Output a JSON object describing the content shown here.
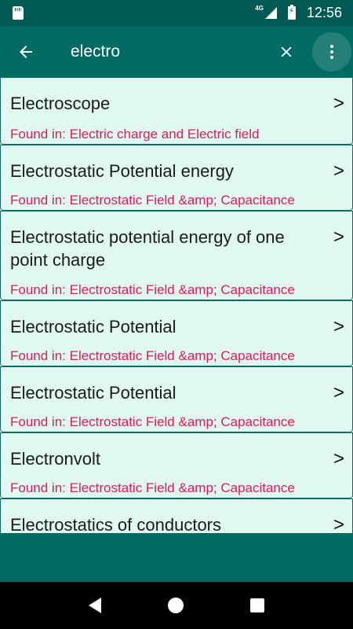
{
  "status_bar": {
    "network": "4G",
    "time": "12:56"
  },
  "search": {
    "value": "electro"
  },
  "results": [
    {
      "title": "Electroscope",
      "found": "Found in: Electric charge and Electric field"
    },
    {
      "title": "Electrostatic Potential energy",
      "found": "Found in: Electrostatic Field &amp; Capacitance"
    },
    {
      "title": "Electrostatic potential energy of one point charge",
      "found": "Found in: Electrostatic Field &amp; Capacitance"
    },
    {
      "title": "Electrostatic Potential",
      "found": "Found in: Electrostatic Field &amp; Capacitance"
    },
    {
      "title": "Electrostatic Potential",
      "found": "Found in: Electrostatic Field &amp; Capacitance"
    },
    {
      "title": "Electronvolt",
      "found": "Found in: Electrostatic Field &amp; Capacitance"
    },
    {
      "title": "Electrostatics of conductors",
      "found": ""
    }
  ],
  "chevron": ">",
  "colors": {
    "toolbar": "#006b63",
    "status_bar": "#005a53",
    "item_bg": "#e1f8f0",
    "found_text": "#e0195a"
  },
  "icons": {
    "back": "arrow-left-icon",
    "clear": "close-icon",
    "menu": "more-vert-icon"
  }
}
